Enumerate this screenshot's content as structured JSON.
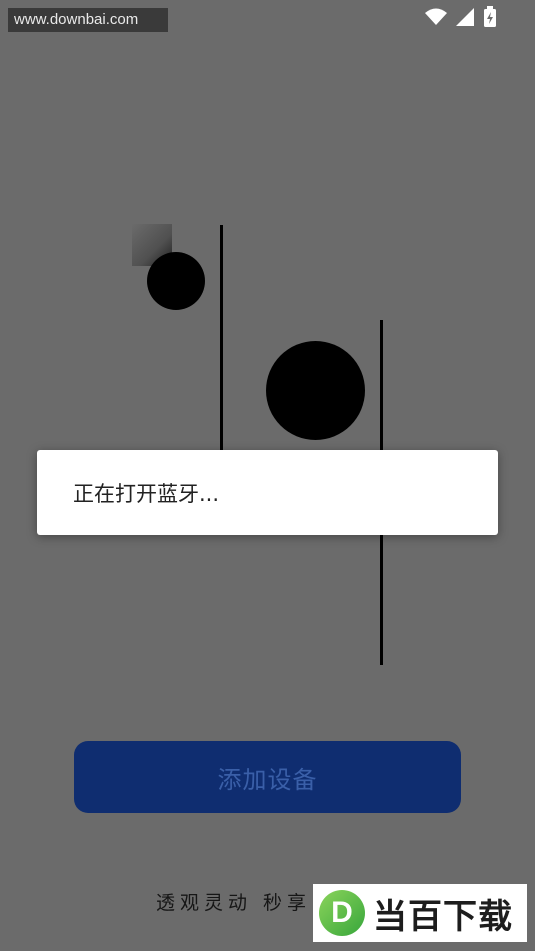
{
  "watermark_top": {
    "text": "www.downbai.com"
  },
  "status_bar": {
    "icons": [
      "wifi-icon",
      "signal-icon",
      "battery-charging-icon"
    ]
  },
  "dialog": {
    "message": "正在打开蓝牙..."
  },
  "primary_button": {
    "label": "添加设备"
  },
  "slogan": {
    "text": "透观灵动 秒享"
  },
  "bottom_logo": {
    "mark": "D",
    "text": "当百下载"
  }
}
